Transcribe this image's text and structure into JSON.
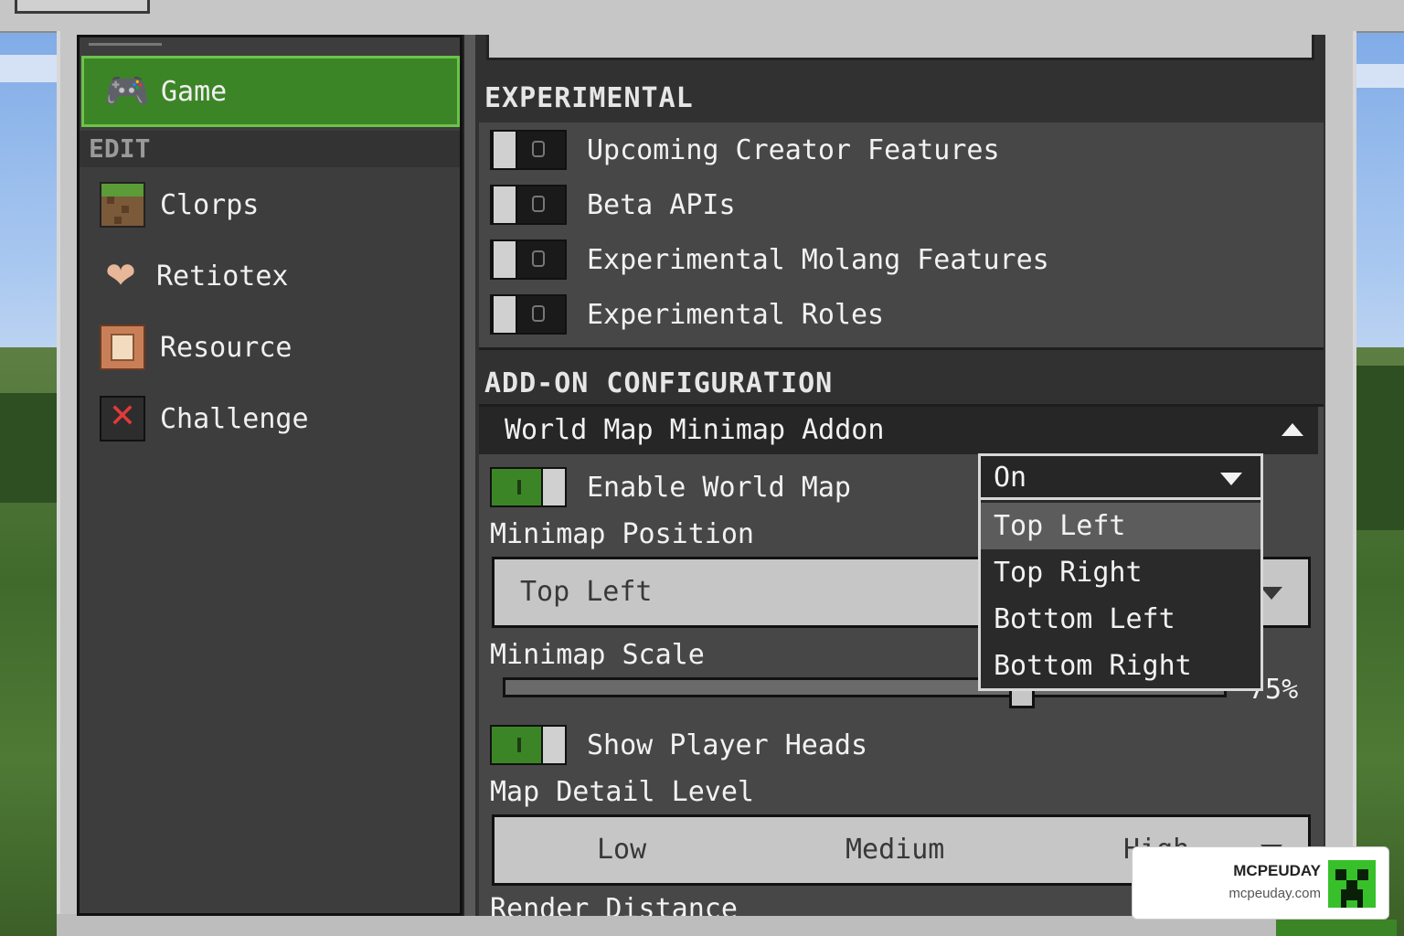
{
  "sidebar": {
    "active_item": {
      "label": "Game",
      "icon": "gamepad-icon"
    },
    "edit_header": "EDIT",
    "items": [
      {
        "label": "Clorps",
        "icon": "grass-block-icon"
      },
      {
        "label": "Retiotex",
        "icon": "controller-icon"
      },
      {
        "label": "Resource",
        "icon": "resource-pack-icon"
      },
      {
        "label": "Challenge",
        "icon": "challenge-x-icon"
      }
    ]
  },
  "experimental": {
    "header": "EXPERIMENTAL",
    "toggles": [
      {
        "label": "Upcoming Creator Features",
        "on": false
      },
      {
        "label": "Beta APIs",
        "on": false
      },
      {
        "label": "Experimental Molang Features",
        "on": false
      },
      {
        "label": "Experimental Roles",
        "on": false
      }
    ]
  },
  "addon": {
    "header": "ADD-ON CONFIGURATION",
    "addon_name": "World Map Minimap Addon",
    "enable_world_map": {
      "label": "Enable World Map",
      "on": true
    },
    "minimap_position": {
      "label": "Minimap Position",
      "value": "Top Left"
    },
    "minimap_scale": {
      "label": "Minimap Scale",
      "value_label": "75%",
      "value": 0.72
    },
    "show_player_heads": {
      "label": "Show Player Heads",
      "on": true
    },
    "map_detail_level": {
      "label": "Map Detail Level",
      "options": [
        "Low",
        "Medium",
        "High"
      ]
    },
    "render_distance": {
      "label": "Render Distance"
    }
  },
  "dropdown": {
    "current": "On",
    "options": [
      "Top Left",
      "Top Right",
      "Bottom Left",
      "Bottom Right"
    ],
    "selected": "Top Left"
  },
  "watermark": {
    "brand": "MCPEUDAY",
    "url": "mcpeuday.com"
  },
  "colors": {
    "accent_green": "#3c8527",
    "panel_dark": "#313131",
    "panel_mid": "#474747",
    "light_gray": "#c6c6c6"
  }
}
